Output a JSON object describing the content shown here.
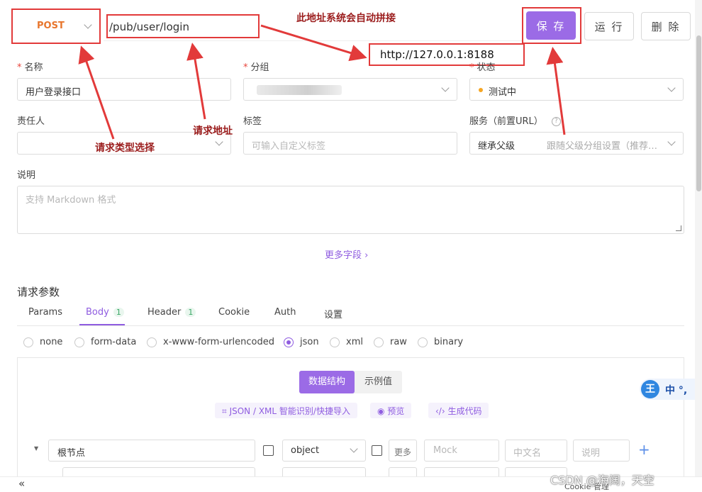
{
  "request": {
    "method": "POST",
    "url": "/pub/user/login",
    "base_url": "http://127.0.0.1:8188",
    "save_label": "保 存",
    "run_label": "运 行",
    "delete_label": "删 除"
  },
  "form": {
    "name_label": "名称",
    "name_value": "用户登录接口",
    "group_label": "分组",
    "status_label": "状态",
    "status_value": "测试中",
    "owner_label": "责任人",
    "tags_label": "标签",
    "tags_placeholder": "可输入自定义标签",
    "service_label": "服务（前置URL）",
    "service_value": "继承父级",
    "service_hint": "跟随父级分组设置（推荐…",
    "desc_label": "说明",
    "desc_placeholder": "支持 Markdown 格式",
    "more_fields": "更多字段 ›"
  },
  "params": {
    "title": "请求参数",
    "tabs": [
      {
        "label": "Params"
      },
      {
        "label": "Body",
        "badge": "1"
      },
      {
        "label": "Header",
        "badge": "1"
      },
      {
        "label": "Cookie"
      },
      {
        "label": "Auth"
      },
      {
        "label": "设置"
      }
    ],
    "body_types": [
      "none",
      "form-data",
      "x-www-form-urlencoded",
      "json",
      "xml",
      "raw",
      "binary"
    ],
    "selected_body_type": "json"
  },
  "body": {
    "mode_structure": "数据结构",
    "mode_example": "示例值",
    "import_label": "JSON / XML 智能识别/快捷导入",
    "preview_label": "预览",
    "codegen_label": "生成代码",
    "root_name": "根节点",
    "root_type": "object",
    "more_label": "更多",
    "mock_placeholder": "Mock",
    "cn_name_placeholder": "中文名",
    "desc_placeholder": "说明"
  },
  "annotations": {
    "auto_concat": "此地址系统会自动拼接",
    "method_select": "请求类型选择",
    "url_label": "请求地址"
  },
  "footer": {
    "collapse": "«",
    "cookie": "Cookie 管理",
    "watermark": "CSDN @海阔，天空"
  },
  "ime": {
    "logo": "王",
    "text": "中 °,"
  },
  "colors": {
    "accent": "#8f5ce0",
    "method": "#e8762d",
    "annotation": "#e23a3a",
    "status_dot": "#f5a623"
  }
}
